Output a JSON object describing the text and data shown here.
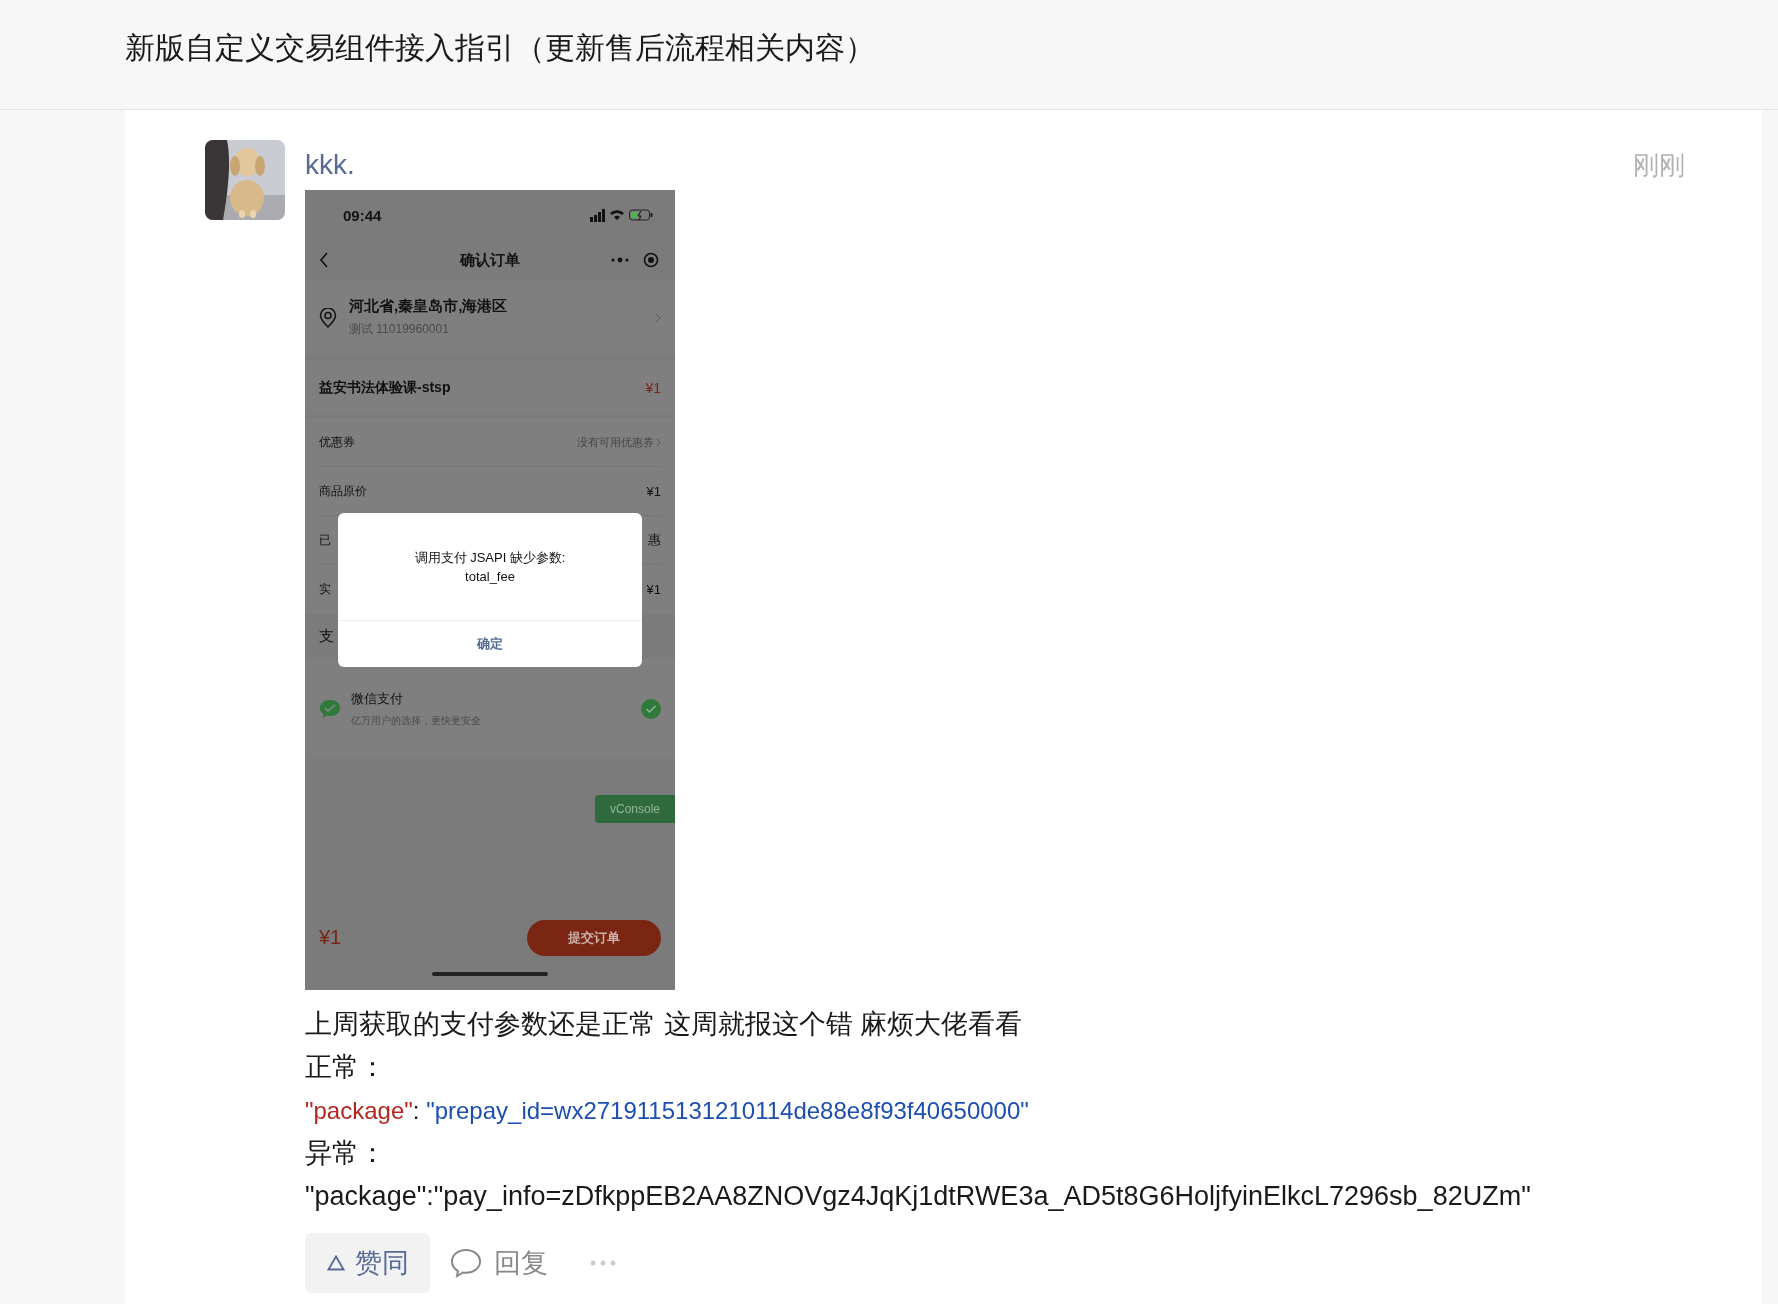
{
  "header": {
    "title": "新版自定义交易组件接入指引（更新售后流程相关内容）"
  },
  "post": {
    "author": "kkk.",
    "time": "刚刚",
    "screenshot": {
      "status_time": "09:44",
      "nav_title": "确认订单",
      "address": {
        "region": "河北省,秦皇岛市,海港区",
        "contact": "测试 11019960001"
      },
      "product": {
        "name": "益安书法体验课-stsp",
        "price": "¥1"
      },
      "rows": [
        {
          "kind": "link",
          "label": "优惠券",
          "value": "没有可用优惠券"
        },
        {
          "kind": "value",
          "label": "商品原价",
          "value": "¥1"
        },
        {
          "kind": "value",
          "label": "已",
          "value": "惠"
        },
        {
          "kind": "value",
          "label": "实",
          "value": "¥1"
        }
      ],
      "section_label": "支",
      "dialog": {
        "message": "调用支付 JSAPI 缺少参数:",
        "detail": "total_fee",
        "button": "确定"
      },
      "payment": {
        "name": "微信支付",
        "note": "亿万用户的选择，更快更安全",
        "selected": true
      },
      "console_button": "vConsole",
      "total": "¥1",
      "submit": "提交订单"
    },
    "body": [
      {
        "kind": "text",
        "text": "上周获取的支付参数还是正常 这周就报这个错 麻烦大佬看看"
      },
      {
        "kind": "text",
        "text": "正常："
      },
      {
        "kind": "code",
        "key": "\"package\"",
        "separator": ": ",
        "value": "\"prepay_id=wx2719115131210114de88e8f93f40650000\""
      },
      {
        "kind": "text",
        "text": "异常："
      },
      {
        "kind": "text",
        "text": "\"package\":\"pay_info=zDfkppEB2AA8ZNOVgz4JqKj1dtRWE3a_AD5t8G6HoljfyinElkcL7296sb_82UZm\""
      }
    ],
    "actions": {
      "like": "赞同",
      "reply": "回复"
    }
  }
}
